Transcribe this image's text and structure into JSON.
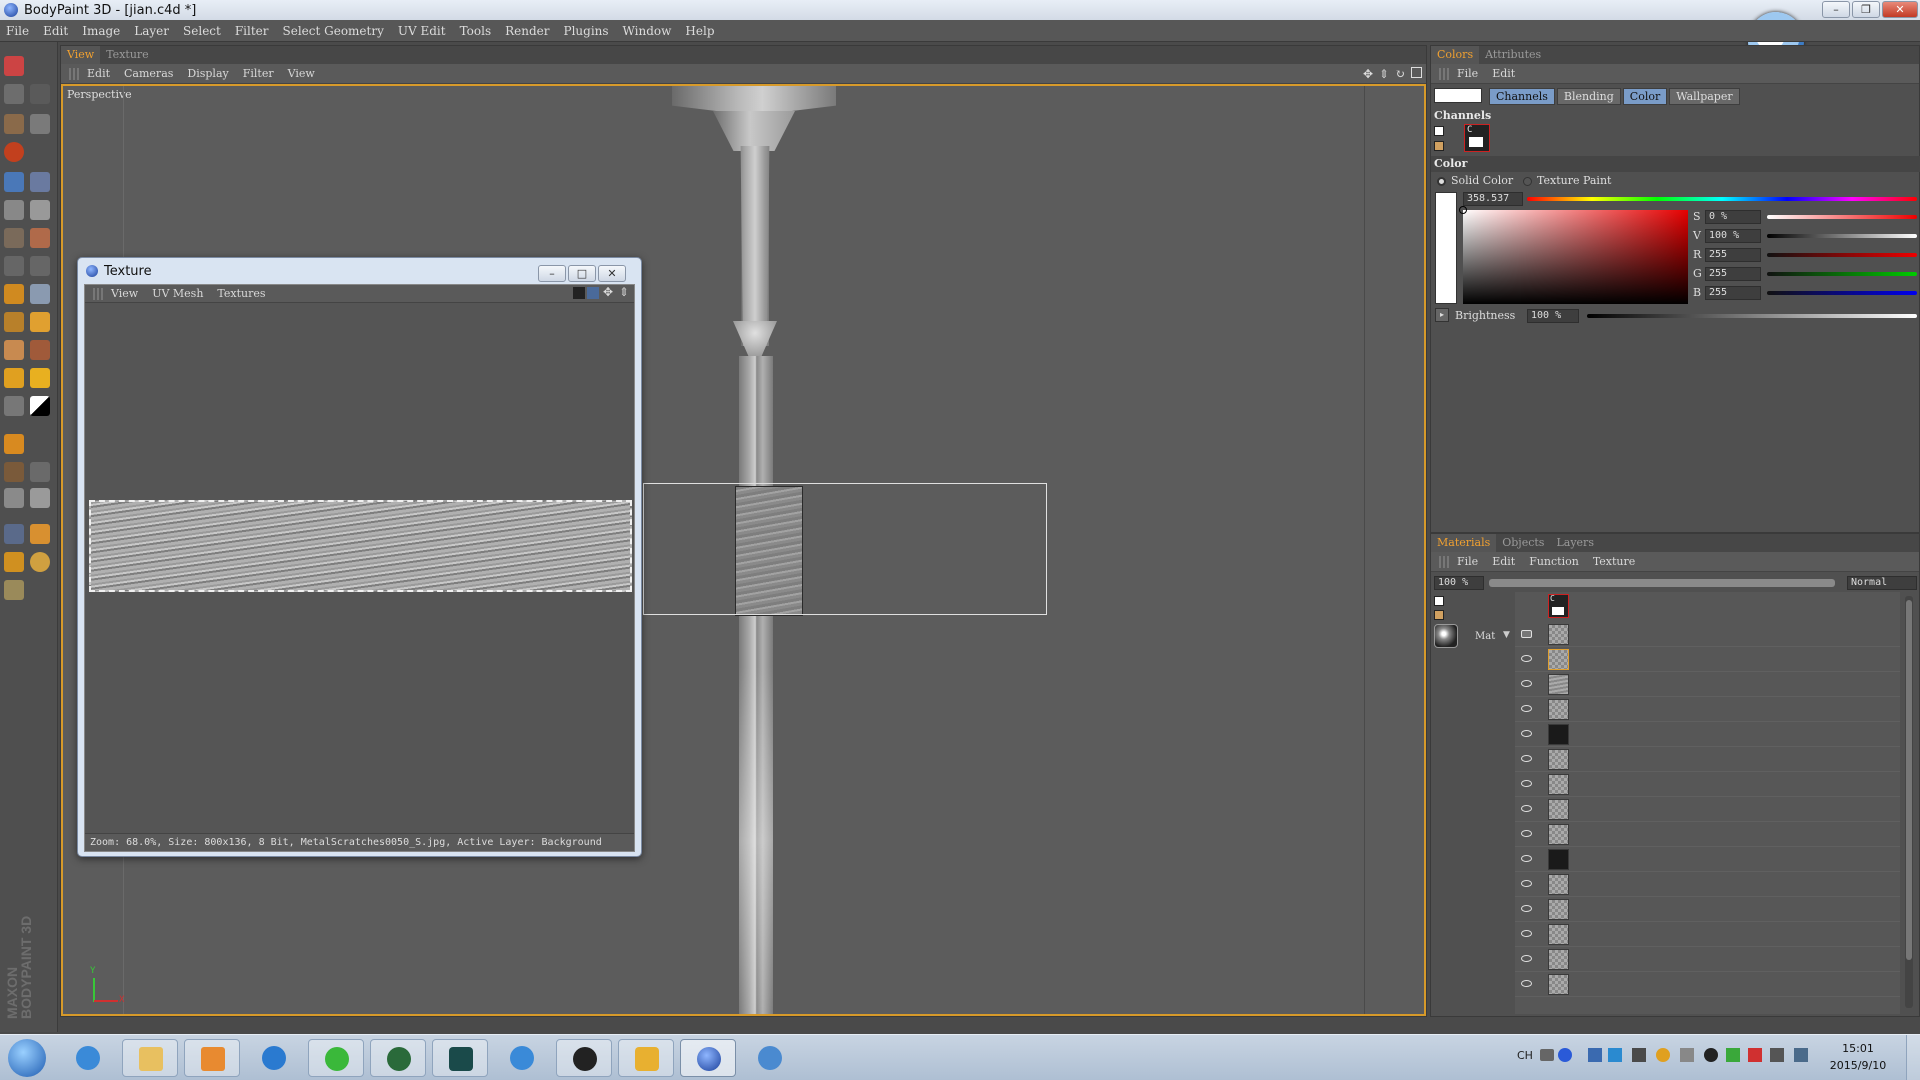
{
  "window": {
    "title": "BodyPaint 3D - [jian.c4d *]"
  },
  "menubar": [
    "File",
    "Edit",
    "Image",
    "Layer",
    "Select",
    "Filter",
    "Select Geometry",
    "UV Edit",
    "Tools",
    "Render",
    "Plugins",
    "Window",
    "Help"
  ],
  "viewpanel": {
    "tabs": [
      "View",
      "Texture"
    ],
    "menu": [
      "Edit",
      "Cameras",
      "Display",
      "Filter",
      "View"
    ],
    "camera_label": "Perspective"
  },
  "texture_window": {
    "title": "Texture",
    "menu": [
      "View",
      "UV Mesh",
      "Textures"
    ],
    "status": "Zoom: 68.0%, Size: 800x136, 8 Bit, MetalScratches0050_S.jpg, Active Layer: Background"
  },
  "colors_panel": {
    "tabs": [
      "Colors",
      "Attributes"
    ],
    "menu": [
      "File",
      "Edit"
    ],
    "mode_buttons": [
      "Channels",
      "Blending",
      "Color",
      "Wallpaper"
    ],
    "channels_label": "Channels",
    "channel_chip": "C",
    "color_label": "Color",
    "radio_solid": "Solid Color",
    "radio_texture": "Texture Paint",
    "hue_value": "358.537",
    "fields": [
      {
        "name": "S",
        "value": "0 %"
      },
      {
        "name": "V",
        "value": "100 %"
      },
      {
        "name": "R",
        "value": "255"
      },
      {
        "name": "G",
        "value": "255"
      },
      {
        "name": "B",
        "value": "255"
      }
    ],
    "brightness_label": "Brightness",
    "brightness_value": "100 %"
  },
  "materials_panel": {
    "tabs": [
      "Materials",
      "Objects",
      "Layers"
    ],
    "menu": [
      "File",
      "Edit",
      "Function",
      "Texture"
    ],
    "opacity": "100 %",
    "blend_mode": "Normal",
    "material_name": "Mat",
    "layer_chip": "C"
  },
  "brand": {
    "line1": "MAXON",
    "line2": "BODYPAINT 3D"
  },
  "axis": {
    "y": "Y",
    "x": "X"
  },
  "system_tray": {
    "lang": "CH",
    "time": "15:01",
    "date": "2015/9/10"
  },
  "colors": {
    "accent": "#d79a2a",
    "viewport_bg": "#5c5c5c",
    "panel_bg": "#505050"
  }
}
